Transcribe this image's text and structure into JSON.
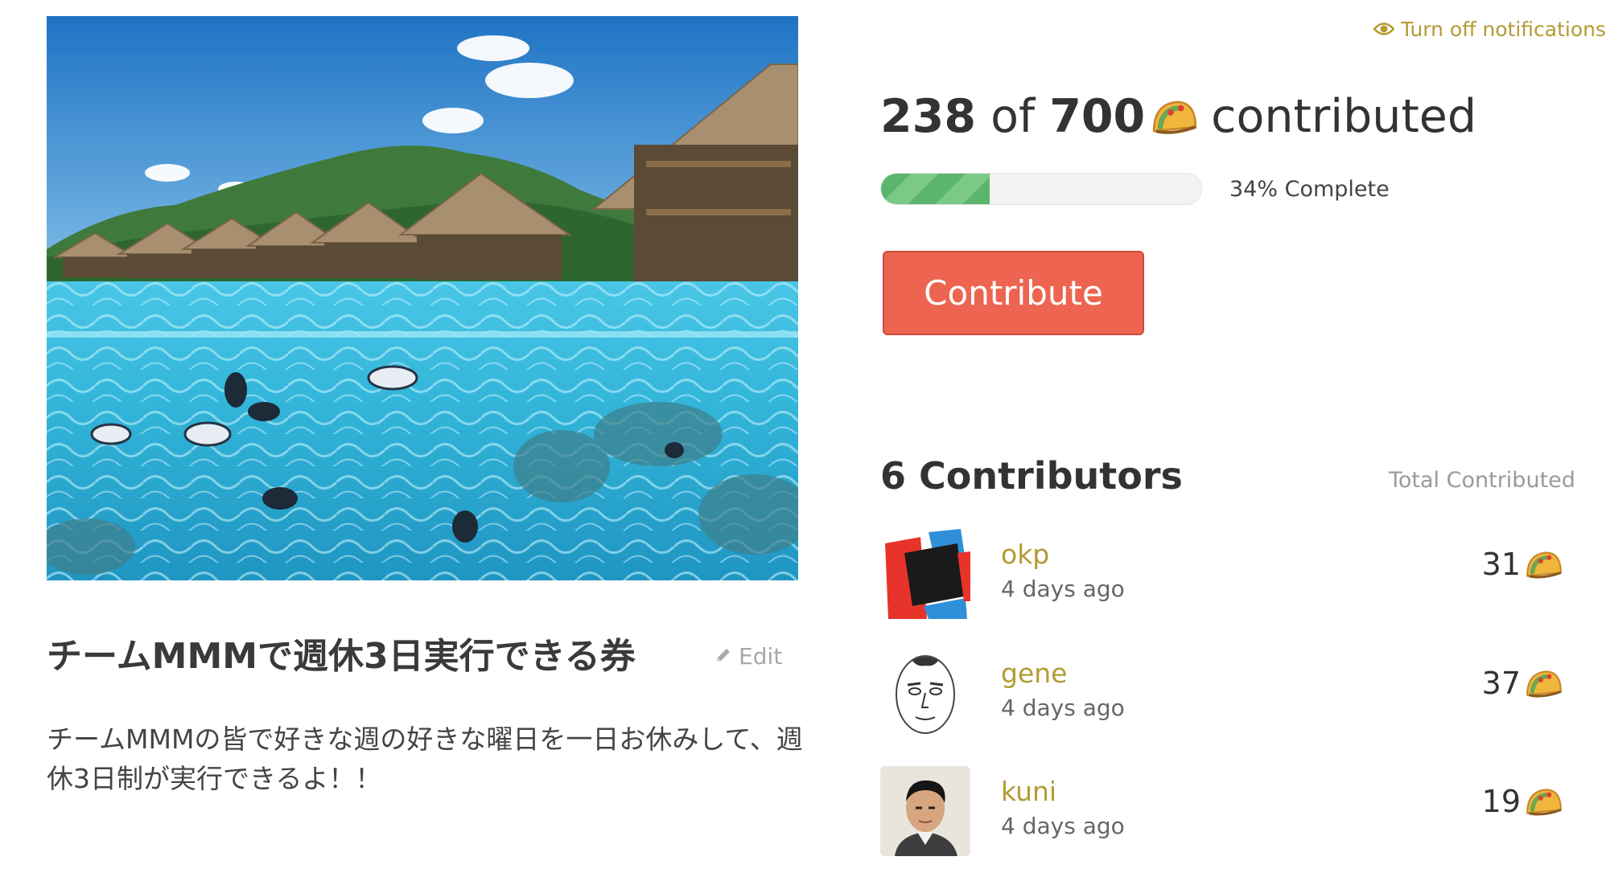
{
  "reward": {
    "title": "チームMMMで週休3日実行できる券",
    "edit_label": "Edit",
    "description": "チームMMMの皆で好きな週の好きな曜日を一日お休みして、週休3日制が実行できるよ！！"
  },
  "notifications": {
    "label": "Turn off notifications",
    "icon": "eye-icon"
  },
  "progress": {
    "contributed": "238",
    "of_word": "of",
    "goal": "700",
    "suffix": "contributed",
    "percent_text": "34% Complete",
    "fraction": 0.34,
    "unit_icon": "taco-icon"
  },
  "contribute_button": {
    "label": "Contribute"
  },
  "contributors": {
    "heading": "6 Contributors",
    "total_label": "Total Contributed",
    "items": [
      {
        "name": "okp",
        "when": "4 days ago",
        "amount": "31",
        "avatar": "abstract-flag-avatar"
      },
      {
        "name": "gene",
        "when": "4 days ago",
        "amount": "37",
        "avatar": "sketch-face-avatar"
      },
      {
        "name": "kuni",
        "when": "4 days ago",
        "amount": "19",
        "avatar": "photo-avatar"
      }
    ]
  },
  "colors": {
    "accent_gold": "#b39b33",
    "button_red": "#ed6450",
    "progress_green": "#5bb56c"
  }
}
